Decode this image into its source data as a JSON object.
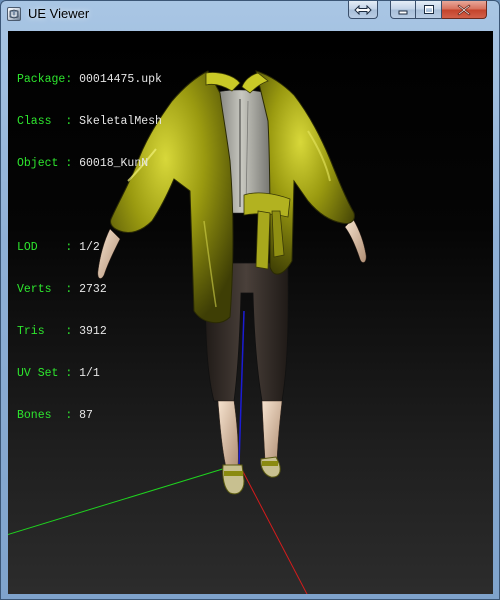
{
  "window": {
    "title": "UE Viewer"
  },
  "info": {
    "package": {
      "label": "Package",
      "value": "00014475.upk"
    },
    "class": {
      "label": "Class  ",
      "value": "SkeletalMesh"
    },
    "object": {
      "label": "Object ",
      "value": "60018_KunN"
    },
    "lod": {
      "label": "LOD    ",
      "value": "1/2"
    },
    "verts": {
      "label": "Verts  ",
      "value": "2732"
    },
    "tris": {
      "label": "Tris   ",
      "value": "3912"
    },
    "uvset": {
      "label": "UV Set ",
      "value": "1/1"
    },
    "bones": {
      "label": "Bones  ",
      "value": "87"
    },
    "separator": ": "
  },
  "colors": {
    "label_green": "#2ee62e",
    "value_white": "#e6e6e6",
    "axis_x": "#d41c1c",
    "axis_y": "#1fd21f",
    "axis_z": "#1c1cd4",
    "robe": "#9a9a10"
  },
  "icons": {
    "app": "ue-viewer-app-icon",
    "restore_size": "double-arrow-icon",
    "minimize": "minimize-icon",
    "maximize": "maximize-icon",
    "close": "close-icon"
  }
}
